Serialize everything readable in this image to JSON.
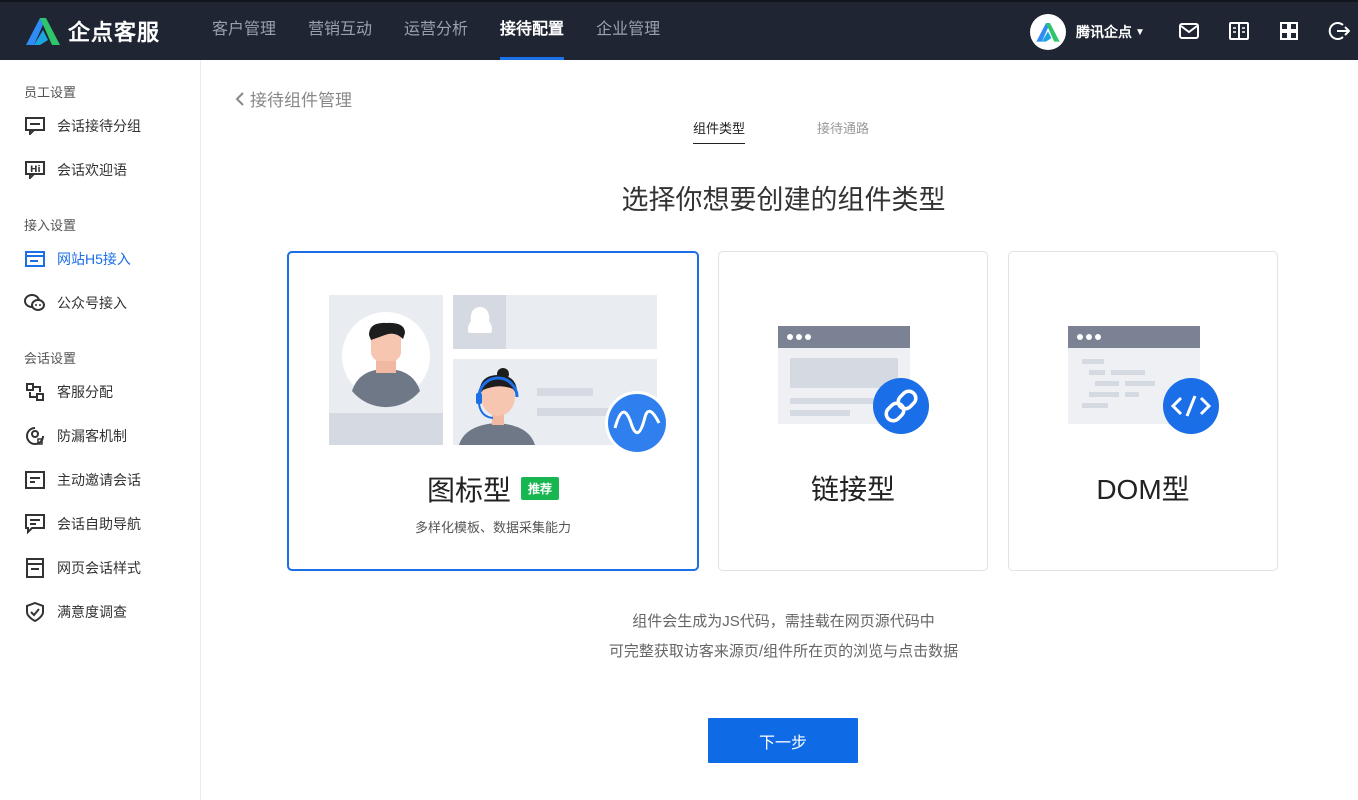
{
  "brand": {
    "name": "企点客服"
  },
  "nav": {
    "items": [
      {
        "label": "客户管理",
        "active": false
      },
      {
        "label": "营销互动",
        "active": false
      },
      {
        "label": "运营分析",
        "active": false
      },
      {
        "label": "接待配置",
        "active": true
      },
      {
        "label": "企业管理",
        "active": false
      }
    ]
  },
  "user": {
    "name": "腾讯企点"
  },
  "sidebar": {
    "groups": [
      {
        "title": "员工设置",
        "items": [
          {
            "label": "会话接待分组"
          },
          {
            "label": "会话欢迎语"
          }
        ]
      },
      {
        "title": "接入设置",
        "items": [
          {
            "label": "网站H5接入",
            "active": true
          },
          {
            "label": "公众号接入"
          }
        ]
      },
      {
        "title": "会话设置",
        "items": [
          {
            "label": "客服分配"
          },
          {
            "label": "防漏客机制"
          },
          {
            "label": "主动邀请会话"
          },
          {
            "label": "会话自助导航"
          },
          {
            "label": "网页会话样式"
          },
          {
            "label": "满意度调查"
          }
        ]
      }
    ]
  },
  "main": {
    "back_label": "接待组件管理",
    "tabs": [
      {
        "label": "组件类型",
        "active": true
      },
      {
        "label": "接待通路",
        "active": false
      }
    ],
    "heading": "选择你想要创建的组件类型",
    "cards": [
      {
        "title": "图标型",
        "badge": "推荐",
        "desc": "多样化模板、数据采集能力",
        "selected": true
      },
      {
        "title": "链接型",
        "selected": false
      },
      {
        "title": "DOM型",
        "selected": false
      }
    ],
    "notes": [
      "组件会生成为JS代码，需挂载在网页源代码中",
      "可完整获取访客来源页/组件所在页的浏览与点击数据"
    ],
    "next_label": "下一步"
  },
  "colors": {
    "accent": "#1a6ee8",
    "topbar": "#1f2533",
    "badge": "#17b651",
    "button": "#0f6ae6"
  }
}
